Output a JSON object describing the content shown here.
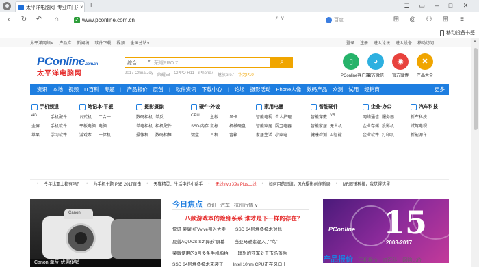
{
  "browser": {
    "tab_title": "太平洋电脑网_专业IT门户",
    "url": "www.pconline.com.cn",
    "address_right": "⚡ ∨",
    "search_placeholder": "百度",
    "device_label": "移动设备书签"
  },
  "site_top": {
    "left": [
      "太平洋网络∨",
      "产品库",
      "新闻稿",
      "软件下载",
      "视频",
      "全国分站∨"
    ],
    "right": [
      "登录",
      "注册",
      "进入论坛",
      "进入设备",
      "移动访问"
    ]
  },
  "header": {
    "logo_main": "PConline",
    "logo_domain": ".com.cn",
    "logo_cn": "太平洋电脑网",
    "search_category": "综合",
    "search_keyword": "荣耀PRO 7",
    "search_button_icon": "search-icon",
    "hotwords": [
      "2017 China Joy",
      "荣耀58",
      "OPPO R11",
      "iPhone7",
      "魅族pro7",
      "华为P10"
    ],
    "apps": [
      {
        "label": "PConline客户端",
        "icon": "phone-icon",
        "color": "#26b36a"
      },
      {
        "label": "官方微信",
        "icon": "wechat-icon",
        "color": "#2db0e0"
      },
      {
        "label": "官方微博",
        "icon": "weibo-icon",
        "color": "#e8423d"
      },
      {
        "label": "产品大全",
        "icon": "tools-icon",
        "color": "#f0a500"
      }
    ]
  },
  "bluenav": [
    "资讯",
    "本地",
    "视频",
    "IT百科",
    "专题",
    "|",
    "产品报价",
    "原创",
    "|",
    "软件资讯",
    "下载中心",
    "|",
    "论坛",
    "摄影活动",
    "Phone人像",
    "数码产品",
    "众测",
    "试用",
    "经销商"
  ],
  "bluenav_more": "更多",
  "categories": [
    {
      "title": "手机频道",
      "rows": [
        [
          "4G",
          "手机配件"
        ],
        [
          "全屏",
          "手机软件"
        ],
        [
          "苹果",
          "学习软件"
        ]
      ]
    },
    {
      "title": "笔记本·平板",
      "rows": [
        [
          "台式机",
          "二合一"
        ],
        [
          "平板电脑",
          "电脑"
        ],
        [
          "游戏本",
          "一体机"
        ]
      ]
    },
    {
      "title": "摄影摄像",
      "rows": [
        [
          "数码相机",
          "单反"
        ],
        [
          "单电相机",
          "相机配件"
        ],
        [
          "摄像机",
          "数码相框"
        ]
      ]
    },
    {
      "title": "硬件·外设",
      "rows": [
        [
          "CPU",
          "主板",
          "显卡"
        ],
        [
          "SSD/内存",
          "鼠标",
          "机械硬盘"
        ],
        [
          "键盘",
          "耳机",
          "音箱"
        ]
      ]
    },
    {
      "title": "家用电器",
      "rows": [
        [
          "智能电视",
          "个人护理"
        ],
        [
          "智能家居",
          "厨卫电器"
        ],
        [
          "家居生活",
          "小家电"
        ]
      ]
    },
    {
      "title": "智能硬件",
      "rows": [
        [
          "智能穿戴",
          "VR"
        ],
        [
          "智能家居",
          "无人机"
        ],
        [
          "健康检测",
          "AI智能"
        ]
      ]
    },
    {
      "title": "企业·办公",
      "rows": [
        [
          "网络通信",
          "服务器"
        ],
        [
          "企业存储",
          "投影机"
        ],
        [
          "企业软件",
          "打印机"
        ]
      ]
    },
    {
      "title": "汽车科技",
      "rows": [
        [
          "新车科技"
        ],
        [
          "试驾电视"
        ],
        [
          "新能源车"
        ]
      ]
    }
  ],
  "ticker": [
    {
      "text": "今年比亚上都有吗？",
      "red": false
    },
    {
      "text": "为手机主题 P8E 2017直击",
      "red": false
    },
    {
      "text": "天猫精灵：生活中的小帮手",
      "red": false
    },
    {
      "text": "无线vivo X9s Plus上线",
      "red": true
    },
    {
      "text": "如何用的思维，风光摄影创作新局",
      "red": false
    },
    {
      "text": "MR眼镜科技，我觉得这里",
      "red": false
    }
  ],
  "focus": {
    "title": "今日焦点",
    "tabs": [
      "资讯",
      "汽车",
      "杭州行情 ∨"
    ],
    "headline": "八款游戏本的险身系系 谁才是下一样的存在？",
    "lines": [
      [
        "快讯  荣耀KFVvive引入大卖",
        "SSD 64层堆叠技术对比"
      ],
      [
        "夏普AQUOS S2“异形”屏幕",
        "当亚马逊素混入了“鸟”"
      ],
      [
        "荣耀使用的3月多条手机指拍",
        "联想的亚军处于市场落后"
      ],
      [
        "SSD 64层堆叠技术来袭了",
        "Intel:10nm CPU正在风口上"
      ]
    ]
  },
  "camera_caption": "Canon 单反 优惠促销",
  "banner": {
    "num": "15",
    "sub": "2003-2017",
    "brand": "PConline"
  },
  "product_tabs": {
    "title": "产品报价",
    "tabs": [
      "手机报价",
      "IT百科",
      "网购比价"
    ]
  }
}
